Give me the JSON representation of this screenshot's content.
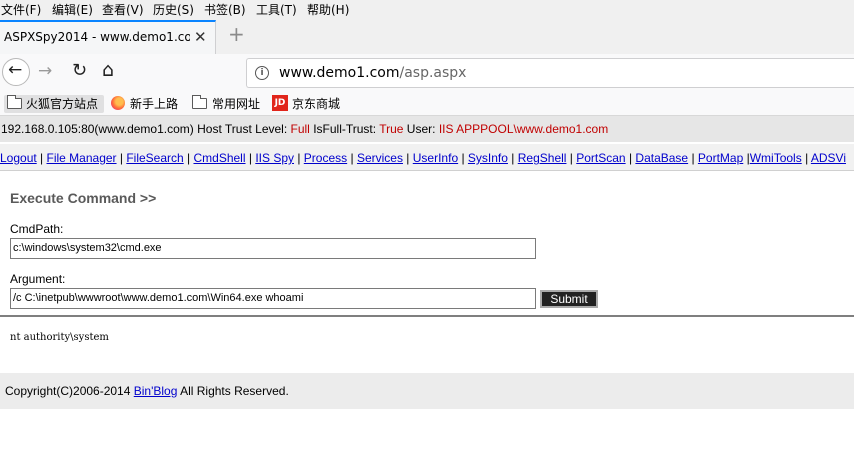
{
  "menu": [
    "文件(F)",
    "编辑(E)",
    "查看(V)",
    "历史(S)",
    "书签(B)",
    "工具(T)",
    "帮助(H)"
  ],
  "tab": {
    "title": "ASPXSpy2014 - www.demo1.com",
    "close": "✕",
    "new": "+"
  },
  "nav": {
    "back": "←",
    "forward": "→",
    "reload": "↻",
    "home": "⌂",
    "url_host": "www.demo1.com",
    "url_path": "/asp.aspx"
  },
  "bookmarks": [
    {
      "label": "火狐官方站点",
      "icon": "folder-icon"
    },
    {
      "label": "新手上路",
      "icon": "firefox-icon"
    },
    {
      "label": "常用网址",
      "icon": "folder-icon"
    },
    {
      "label": "京东商城",
      "icon": "jd-icon"
    }
  ],
  "info": {
    "host": "192.168.0.105:80(www.demo1.com)",
    "trust_label": "Host Trust Level:",
    "trust_value": "Full",
    "fulltrust_label": "IsFull-Trust:",
    "fulltrust_value": "True",
    "user_label": "User:",
    "user_value": "IIS APPPOOL\\www.demo1.com"
  },
  "links": [
    "Logout",
    "File Manager",
    "FileSearch",
    "CmdShell",
    "IIS Spy",
    "Process",
    "Services",
    "UserInfo",
    "SysInfo",
    "RegShell",
    "PortScan",
    "DataBase",
    "PortMap",
    "WmiTools",
    "ADSVi"
  ],
  "command": {
    "heading": "Execute Command >>",
    "cmdpath_label": "CmdPath:",
    "cmdpath_value": "c:\\windows\\system32\\cmd.exe",
    "argument_label": "Argument:",
    "argument_value": "/c C:\\inetpub\\wwwroot\\www.demo1.com\\Win64.exe whoami",
    "submit": "Submit",
    "output": "nt authority\\system"
  },
  "footer": {
    "prefix": "Copyright(C)2006-2014 ",
    "link": "Bin'Blog",
    "suffix": " All Rights Reserved."
  },
  "colors": {
    "accent_tab": "#0a84ff",
    "value_red": "#c00000",
    "link_blue": "#0000cc"
  }
}
